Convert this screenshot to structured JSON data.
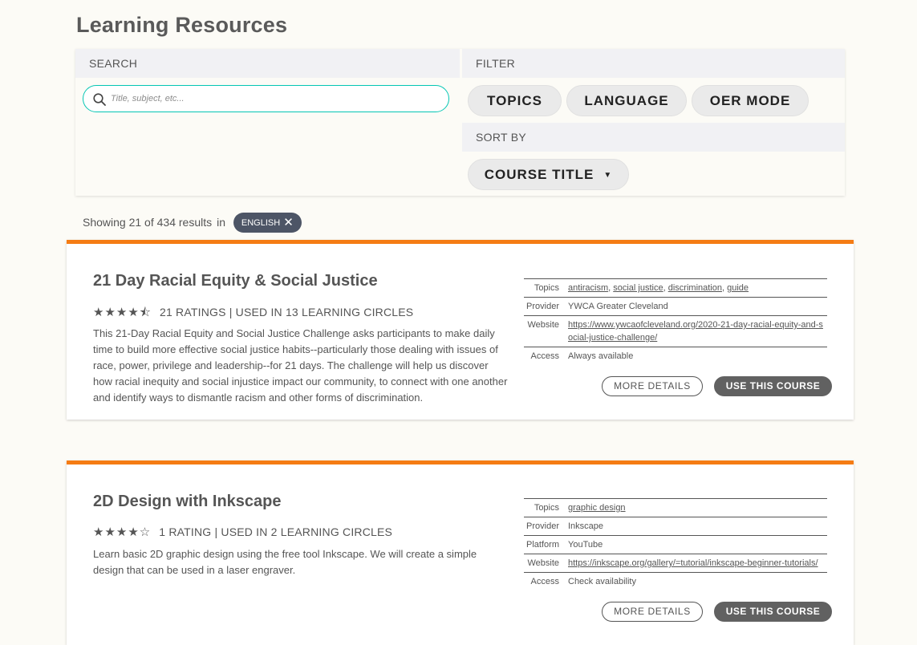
{
  "page": {
    "title": "Learning Resources"
  },
  "search": {
    "header": "SEARCH",
    "placeholder": "Title, subject, etc...",
    "value": ""
  },
  "filter": {
    "header": "FILTER",
    "buttons": [
      "TOPICS",
      "LANGUAGE",
      "OER MODE"
    ]
  },
  "sort": {
    "header": "SORT BY",
    "selected": "COURSE TITLE",
    "caret": "▼"
  },
  "results": {
    "text": "Showing 21 of 434 results",
    "in_word": "in",
    "language_badge": "ENGLISH",
    "badge_close": "✕"
  },
  "colors": {
    "accent_orange": "#f57c14",
    "search_border": "#05c6b4",
    "badge_bg": "#4d5566",
    "button_dark": "#616161"
  },
  "courses": [
    {
      "title": "21 Day Racial Equity & Social Justice",
      "stars": "★★★★⯪",
      "rating": 4.5,
      "rating_text": "21 RATINGS | USED IN 13 LEARNING CIRCLES",
      "description": "This 21-Day Racial Equity and Social Justice Challenge asks participants to make daily time to build more effective social justice habits--particularly those dealing with issues of race, power, privilege and leadership--for 21 days. The challenge will help us discover how racial inequity and social injustice impact our community, to connect with one another and identify ways to dismantle racism and other forms of discrimination.",
      "meta": {
        "topics_label": "Topics",
        "topics": [
          "antiracism",
          "social justice",
          "discrimination",
          "guide"
        ],
        "provider_label": "Provider",
        "provider": "YWCA Greater Cleveland",
        "website_label": "Website",
        "website": "https://www.ywcaofcleveland.org/2020-21-day-racial-equity-and-social-justice-challenge/",
        "access_label": "Access",
        "access": "Always available"
      },
      "more_details": "MORE DETAILS",
      "use_course": "USE THIS COURSE"
    },
    {
      "title": "2D Design with Inkscape",
      "stars": "★★★★☆",
      "rating": 4,
      "rating_text": "1 RATING | USED IN 2 LEARNING CIRCLES",
      "description": "Learn basic 2D graphic design using the free tool Inkscape. We will create a simple design that can be used in a laser engraver.",
      "meta": {
        "topics_label": "Topics",
        "topics": [
          "graphic design"
        ],
        "provider_label": "Provider",
        "provider": "Inkscape",
        "platform_label": "Platform",
        "platform": "YouTube",
        "website_label": "Website",
        "website": "https://inkscape.org/gallery/=tutorial/inkscape-beginner-tutorials/",
        "access_label": "Access",
        "access": "Check availability"
      },
      "more_details": "MORE DETAILS",
      "use_course": "USE THIS COURSE"
    }
  ]
}
